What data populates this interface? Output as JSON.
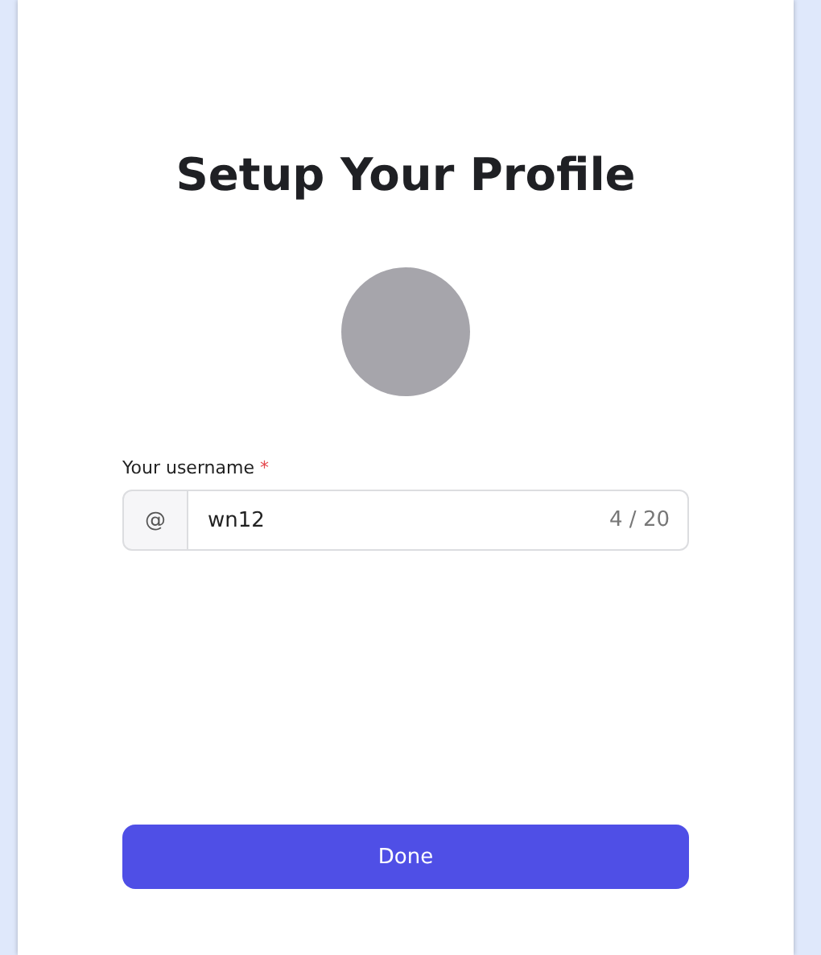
{
  "title": "Setup Your Profile",
  "avatar": {
    "kind": "placeholder"
  },
  "username": {
    "label": "Your username",
    "required_mark": "*",
    "prefix": "@",
    "value": "wn12",
    "counter": "4 / 20"
  },
  "button": {
    "label": "Done"
  }
}
